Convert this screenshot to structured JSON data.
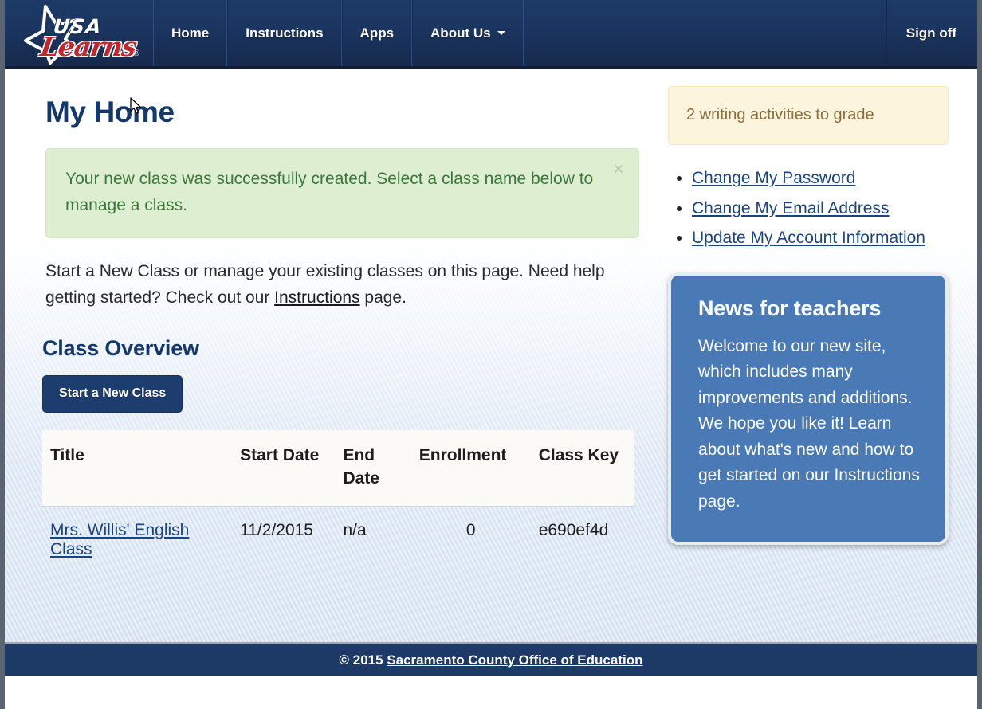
{
  "navbar": {
    "brand": {
      "usa": "USA",
      "learns": "Learns",
      "registered": "®"
    },
    "items": [
      {
        "label": "Home",
        "has_caret": false
      },
      {
        "label": "Instructions",
        "has_caret": false
      },
      {
        "label": "Apps",
        "has_caret": false
      },
      {
        "label": "About Us",
        "has_caret": true
      }
    ],
    "sign_off_label": "Sign off"
  },
  "main": {
    "page_title": "My Home",
    "alert": {
      "message": "Your new class was successfully created. Select a class name below to manage a class.",
      "close_label": "×"
    },
    "intro": {
      "before_link": "Start a New Class or manage your existing classes on this page. Need help getting started? Check out our ",
      "link_text": "Instructions",
      "after_link": " page."
    },
    "section_title": "Class Overview",
    "start_class_button": "Start a New Class",
    "table": {
      "headers": [
        "Title",
        "Start Date",
        "End Date",
        "Enrollment",
        "Class Key"
      ],
      "rows": [
        {
          "title": "Mrs. Willis' English Class",
          "start_date": "11/2/2015",
          "end_date": "n/a",
          "enrollment": "0",
          "class_key": "e690ef4d"
        }
      ]
    }
  },
  "sidebar": {
    "grading_notice": "2 writing activities to grade",
    "account_links": [
      "Change My Password",
      "Change My Email Address",
      "Update My Account Information"
    ],
    "news": {
      "title": "News for teachers",
      "body": "Welcome to our new site, which includes many improvements and additions. We hope you like it! Learn about what's new and how to get started on our Instructions page."
    }
  },
  "footer": {
    "copyright": "© 2015 ",
    "org_link": "Sacramento County Office of Education"
  },
  "colors": {
    "navy": "#1d3a67",
    "heading_blue": "#13386b",
    "link_blue": "#1a4480",
    "success_green": "#3c763d",
    "success_bg": "#ddefd0",
    "warning_brown": "#8a6d3b",
    "warning_bg": "#fcf4dd",
    "news_blue": "#4a7ab5",
    "logo_red": "#c1272d"
  }
}
